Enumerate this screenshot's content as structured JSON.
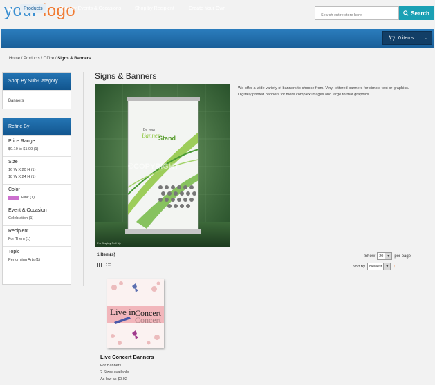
{
  "header": {
    "logo_part1": "your",
    "logo_part2": "logo",
    "search_placeholder": "Search entire store here",
    "search_button": "Search"
  },
  "nav": {
    "home_icon": "home-icon",
    "items": [
      "Products",
      "Shop by Events & Occasions",
      "Shop by Recipient",
      "Create Your Own"
    ],
    "cart_label": "0 items"
  },
  "breadcrumb": {
    "trail": "Home / Products / Office / ",
    "current": "Signs & Banners"
  },
  "sidebar": {
    "subcategory_heading": "Shop By Sub-Category",
    "subcategories": [
      "Banners"
    ],
    "refine_heading": "Refine By",
    "facets": [
      {
        "title": "Price Range",
        "items": [
          "$0.10 to $1.00 (1)"
        ]
      },
      {
        "title": "Size",
        "items": [
          "16 W X 20 H (1)",
          "18 W X 24 H (1)"
        ]
      },
      {
        "title": "Color",
        "items": [
          "Pink (1)"
        ]
      },
      {
        "title": "Event & Occasion",
        "items": [
          "Celebration (1)"
        ]
      },
      {
        "title": "Recipient",
        "items": [
          "For Them (1)"
        ]
      },
      {
        "title": "Topic",
        "items": [
          "Performing Arts (1)"
        ]
      }
    ],
    "color_swatch": "#cc6fce"
  },
  "main": {
    "title": "Signs & Banners",
    "description": "We offer a wide variety of banners to choose from. Vinyl lettered banners for simple text or graphics. Digitally printed banners for more complex images and large format graphics.",
    "hero_banner_text1": "Be your",
    "hero_banner_text2": "Banner",
    "hero_banner_text3": "Stand",
    "hero_watermark": "©COPYRIGHT",
    "hero_caption": "Pro Display Roll Up",
    "items_count": "1 Item(s)",
    "show_label": "Show",
    "show_value": "20",
    "per_page_label": "per page",
    "sort_label": "Sort By",
    "sort_value": "Newest"
  },
  "product": {
    "thumb_text1": "Live in",
    "thumb_text2": "Concert",
    "name": "Live Concert Banners",
    "category": "For Banners",
    "sizes": "2 Sizes available",
    "price": "As low as $0.92"
  },
  "colors": {
    "nav": "#1a5f99",
    "accent": "#1aa0b4",
    "logo_blue": "#3a8fd1",
    "logo_orange": "#f07b33"
  }
}
